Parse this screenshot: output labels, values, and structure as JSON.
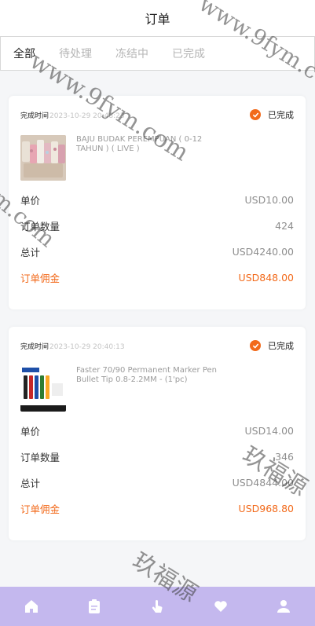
{
  "header": {
    "title": "订单"
  },
  "tabs": [
    {
      "label": "全部",
      "active": true
    },
    {
      "label": "待处理",
      "active": false
    },
    {
      "label": "冻结中",
      "active": false
    },
    {
      "label": "已完成",
      "active": false
    }
  ],
  "orders": [
    {
      "time_label": "完成时间",
      "time_value": "2023-10-29 20:48:23",
      "status": "已完成",
      "product_name": "BAJU BUDAK PEREMPUAN ( 0-12 TAHUN ) ( LIVE )",
      "unit_price_label": "单价",
      "unit_price": "USD10.00",
      "qty_label": "订单数量",
      "qty": "424",
      "total_label": "总计",
      "total": "USD4240.00",
      "commission_label": "订单佣金",
      "commission": "USD848.00"
    },
    {
      "time_label": "完成时间",
      "time_value": "2023-10-29 20:40:13",
      "status": "已完成",
      "product_name": "Faster 70/90 Permanent Marker Pen Bullet Tip 0.8-2.2MM - (1'pc)",
      "unit_price_label": "单价",
      "unit_price": "USD14.00",
      "qty_label": "订单数量",
      "qty": "346",
      "total_label": "总计",
      "total": "USD4844.00",
      "commission_label": "订单佣金",
      "commission": "USD968.80"
    }
  ],
  "watermarks": [
    "www.9fym.com",
    "www.9fym.com",
    "m.com",
    "玖福源",
    "玖福源"
  ],
  "nav_icons": [
    "home-icon",
    "clipboard-icon",
    "tap-icon",
    "heart-icon",
    "user-icon"
  ],
  "colors": {
    "accent": "#f26a1b",
    "tabbar": "#c4b8ee"
  }
}
